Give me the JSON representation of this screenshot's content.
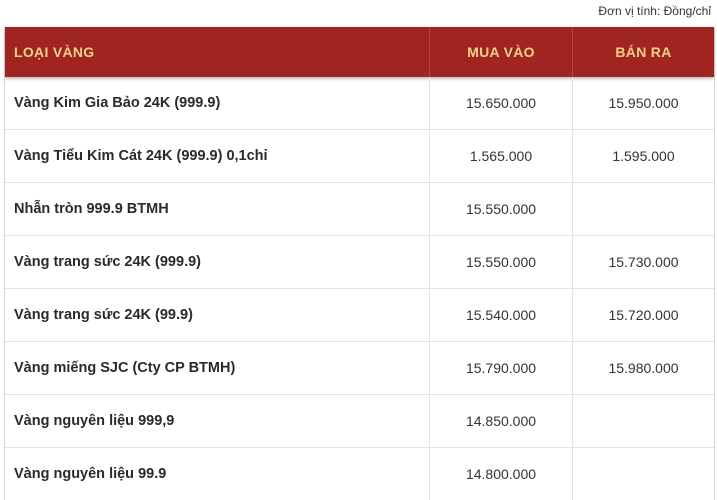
{
  "unit_note": "Đơn vị tính: Đồng/chỉ",
  "table": {
    "headers": {
      "name": "LOẠI VÀNG",
      "buy": "MUA VÀO",
      "sell": "BÁN RA"
    },
    "rows": [
      {
        "name": "Vàng Kim Gia Bảo 24K (999.9)",
        "buy": "15.650.000",
        "sell": "15.950.000"
      },
      {
        "name": "Vàng Tiểu Kim Cát 24K (999.9) 0,1chỉ",
        "buy": "1.565.000",
        "sell": "1.595.000"
      },
      {
        "name": "Nhẫn tròn 999.9 BTMH",
        "buy": "15.550.000",
        "sell": ""
      },
      {
        "name": "Vàng trang sức 24K (999.9)",
        "buy": "15.550.000",
        "sell": "15.730.000"
      },
      {
        "name": "Vàng trang sức 24K (99.9)",
        "buy": "15.540.000",
        "sell": "15.720.000"
      },
      {
        "name": "Vàng miếng SJC (Cty CP BTMH)",
        "buy": "15.790.000",
        "sell": "15.980.000"
      },
      {
        "name": "Vàng nguyên liệu 999,9",
        "buy": "14.850.000",
        "sell": ""
      },
      {
        "name": "Vàng nguyên liệu 99.9",
        "buy": "14.800.000",
        "sell": ""
      }
    ]
  },
  "colors": {
    "header_bg": "#a0241f",
    "header_text": "#f2d28a"
  }
}
